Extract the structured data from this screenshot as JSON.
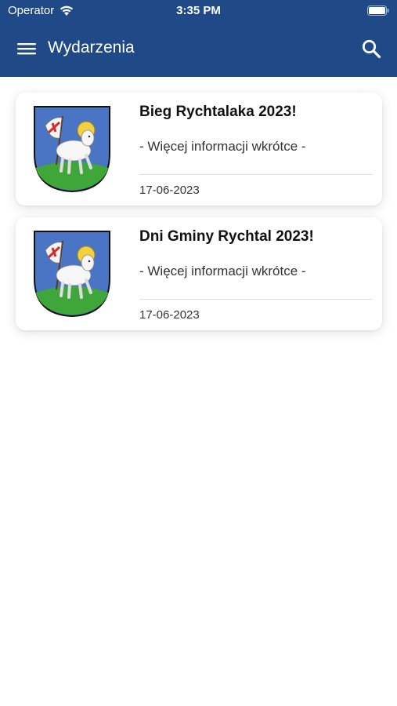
{
  "status_bar": {
    "carrier": "Operator",
    "time": "3:35 PM",
    "wifi_icon": "wifi-icon",
    "battery_icon": "battery-icon"
  },
  "app_bar": {
    "title": "Wydarzenia",
    "menu_icon": "hamburger-menu-icon",
    "search_icon": "search-icon",
    "background_color": "#1f4a87"
  },
  "events": [
    {
      "title": "Bieg Rychtalaka 2023!",
      "description": "- Więcej informacji wkrótce -",
      "date": "17-06-2023",
      "image": "coat-of-arms-lamb"
    },
    {
      "title": "Dni Gminy Rychtal 2023!",
      "description": "- Więcej informacji wkrótce -",
      "date": "17-06-2023",
      "image": "coat-of-arms-lamb"
    }
  ]
}
